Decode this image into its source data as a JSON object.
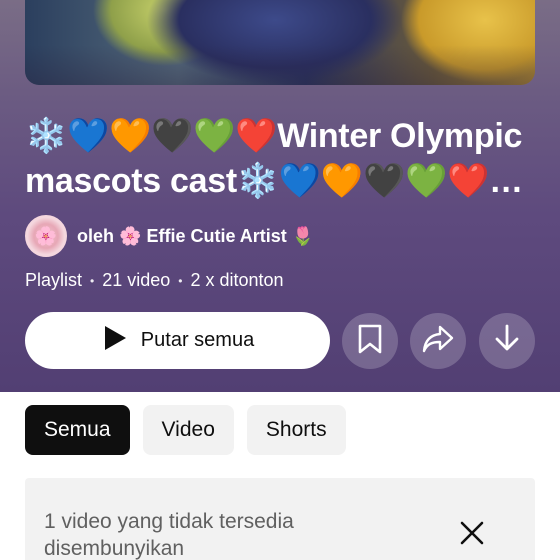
{
  "playlist": {
    "title": "❄️💙🧡🖤💚❤️Winter Olympic mascots cast❄️💙🧡🖤💚❤️Winter Olympic mascots cast",
    "owner_prefix": "oleh",
    "owner_name": "🌸 Effie Cutie Artist 🌷",
    "type": "Playlist",
    "video_count": "21 video",
    "views": "2 x ditonton"
  },
  "actions": {
    "play_all_label": "Putar semua",
    "save_icon": "bookmark-icon",
    "share_icon": "share-icon",
    "download_icon": "download-icon"
  },
  "filters": {
    "chips": [
      {
        "label": "Semua",
        "active": true
      },
      {
        "label": "Video",
        "active": false
      },
      {
        "label": "Shorts",
        "active": false
      }
    ]
  },
  "notice": {
    "text": "1 video yang tidak tersedia disembunyikan",
    "close_icon": "close-icon"
  },
  "colors": {
    "hero_bg": "#5e4a7e",
    "active_chip": "#0f0f0f",
    "chip_bg": "#f2f2f2"
  }
}
